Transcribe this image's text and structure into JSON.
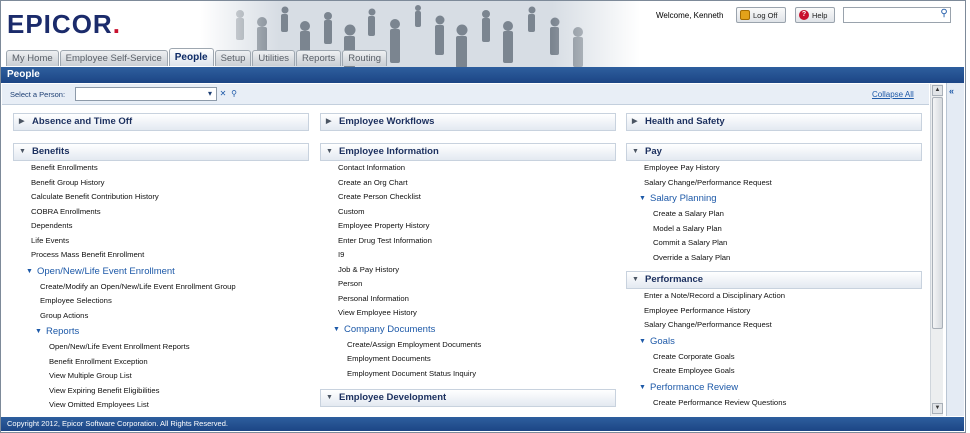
{
  "header": {
    "logo": "EPICOR",
    "welcome": "Welcome, Kenneth",
    "logoff_label": "Log Off",
    "help_label": "Help",
    "search_value": ""
  },
  "tabs": [
    {
      "label": "My Home"
    },
    {
      "label": "Employee Self-Service"
    },
    {
      "label": "People"
    },
    {
      "label": "Setup"
    },
    {
      "label": "Utilities"
    },
    {
      "label": "Reports"
    },
    {
      "label": "Routing"
    }
  ],
  "page_title": "People",
  "person_bar": {
    "label": "Select a Person:",
    "value": "",
    "collapse_all": "Collapse All"
  },
  "columns": {
    "col1": {
      "absence": "Absence and Time Off",
      "benefits": "Benefits",
      "benefit_items": [
        "Benefit Enrollments",
        "Benefit Group History",
        "Calculate Benefit Contribution History",
        "COBRA Enrollments",
        "Dependents",
        "Life Events",
        "Process Mass Benefit Enrollment"
      ],
      "open_enrollment": "Open/New/Life Event Enrollment",
      "open_items": [
        "Create/Modify an Open/New/Life Event Enrollment Group",
        "Employee Selections",
        "Group Actions"
      ],
      "reports": "Reports",
      "report_items": [
        "Open/New/Life Event Enrollment Reports",
        "Benefit Enrollment Exception",
        "View Multiple Group List",
        "View Expiring Benefit Eligibilities",
        "View Omitted Employees List"
      ]
    },
    "col2": {
      "workflows": "Employee Workflows",
      "info": "Employee Information",
      "info_items": [
        "Contact Information",
        "Create an Org Chart",
        "Create Person Checklist",
        "Custom",
        "Employee Property History",
        "Enter Drug Test Information",
        "I9",
        "Job & Pay History",
        "Person",
        "Personal Information",
        "View Employee History"
      ],
      "company_docs": "Company Documents",
      "doc_items": [
        "Create/Assign Employment Documents",
        "Employment Documents",
        "Employment Document Status Inquiry"
      ],
      "development": "Employee Development"
    },
    "col3": {
      "health": "Health and Safety",
      "pay": "Pay",
      "pay_items": [
        "Employee Pay History",
        "Salary Change/Performance Request"
      ],
      "salary_planning": "Salary Planning",
      "salary_items": [
        "Create a Salary Plan",
        "Model a Salary Plan",
        "Commit a Salary Plan",
        "Override a Salary Plan"
      ],
      "performance": "Performance",
      "perf_items": [
        "Enter a Note/Record a Disciplinary Action",
        "Employee Performance History",
        "Salary Change/Performance Request"
      ],
      "goals": "Goals",
      "goal_items": [
        "Create Corporate Goals",
        "Create Employee Goals"
      ],
      "perf_review": "Performance Review",
      "review_items": [
        "Create Performance Review Questions"
      ]
    }
  },
  "footer": "Copyright 2012, Epicor Software Corporation. All Rights Reserved.",
  "colors": {
    "brand_navy": "#1b2b6b",
    "brand_red": "#c8102e",
    "title_bar": "#1c4585",
    "link_blue": "#1d59a8"
  }
}
